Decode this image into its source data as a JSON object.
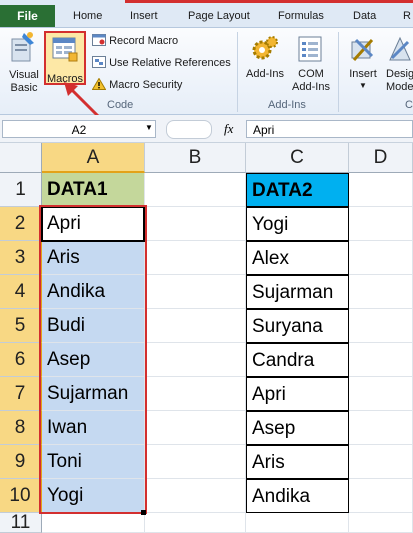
{
  "ribbon_tabs": [
    "File",
    "Home",
    "Insert",
    "Page Layout",
    "Formulas",
    "Data",
    "R"
  ],
  "ribbon": {
    "visual_basic": "Visual Basic",
    "macros": "Macros",
    "record_macro": "Record Macro",
    "relative_refs": "Use Relative References",
    "macro_security": "Macro Security",
    "code_group": "Code",
    "addins": "Add-Ins",
    "com_addins": "COM Add-Ins",
    "addins_group": "Add-Ins",
    "insert": "Insert",
    "design_mode": "Design Mode",
    "controls_group_partial": "C"
  },
  "formula_bar": {
    "name_box": "A2",
    "fx": "fx",
    "value": "Apri"
  },
  "columns": [
    "A",
    "B",
    "C",
    "D"
  ],
  "rows": [
    "1",
    "2",
    "3",
    "4",
    "5",
    "6",
    "7",
    "8",
    "9",
    "10",
    "11"
  ],
  "data1": {
    "header": "DATA1",
    "values": [
      "Apri",
      "Aris",
      "Andika",
      "Budi",
      "Asep",
      "Sujarman",
      "Iwan",
      "Toni",
      "Yogi"
    ]
  },
  "data2": {
    "header": "DATA2",
    "values": [
      "Yogi",
      "Alex",
      "Sujarman",
      "Suryana",
      "Candra",
      "Apri",
      "Asep",
      "Aris",
      "Andika"
    ]
  },
  "colors": {
    "file_tab": "#2a6f34",
    "data1_header": "#c4d79b",
    "data2_header": "#00b0f0",
    "selection": "#c5d9f1",
    "highlight_red": "#d32f2f"
  }
}
